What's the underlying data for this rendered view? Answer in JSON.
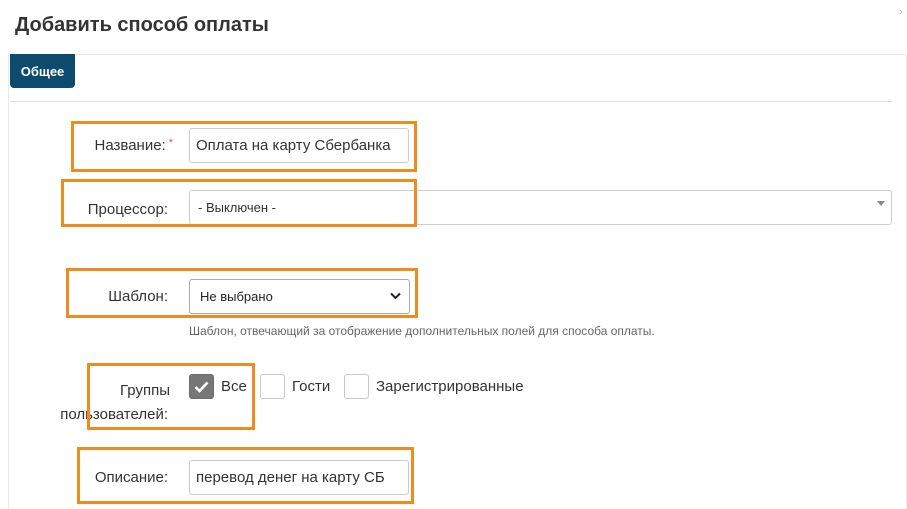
{
  "dialog": {
    "title": "Добавить способ оплаты"
  },
  "tabs": [
    {
      "label": "Общее",
      "active": true
    }
  ],
  "form": {
    "name": {
      "label": "Название:",
      "required_mark": "*",
      "value": "Оплата на карту Сбербанка"
    },
    "processor": {
      "label": "Процессор:",
      "selected": "- Выключен -"
    },
    "template": {
      "label": "Шаблон:",
      "selected": "Не выбрано",
      "help": "Шаблон, отвечающий за отображение дополнительных полей для способа оплаты."
    },
    "user_groups": {
      "label_line1": "Группы",
      "label_line2": "пользователей:",
      "options": [
        {
          "label": "Все",
          "checked": true
        },
        {
          "label": "Гости",
          "checked": false
        },
        {
          "label": "Зарегистрированные",
          "checked": false
        }
      ]
    },
    "description": {
      "label": "Описание:",
      "value": "перевод денег на карту СБ"
    }
  },
  "colors": {
    "tab_active": "#0c4a6e",
    "highlight": "#f08c1e",
    "required": "#d9534f",
    "checkbox_checked": "#777777"
  },
  "icons": {
    "collapse": "chevron-right-icon",
    "check": "check-icon",
    "dropdown": "chevron-down-icon"
  }
}
